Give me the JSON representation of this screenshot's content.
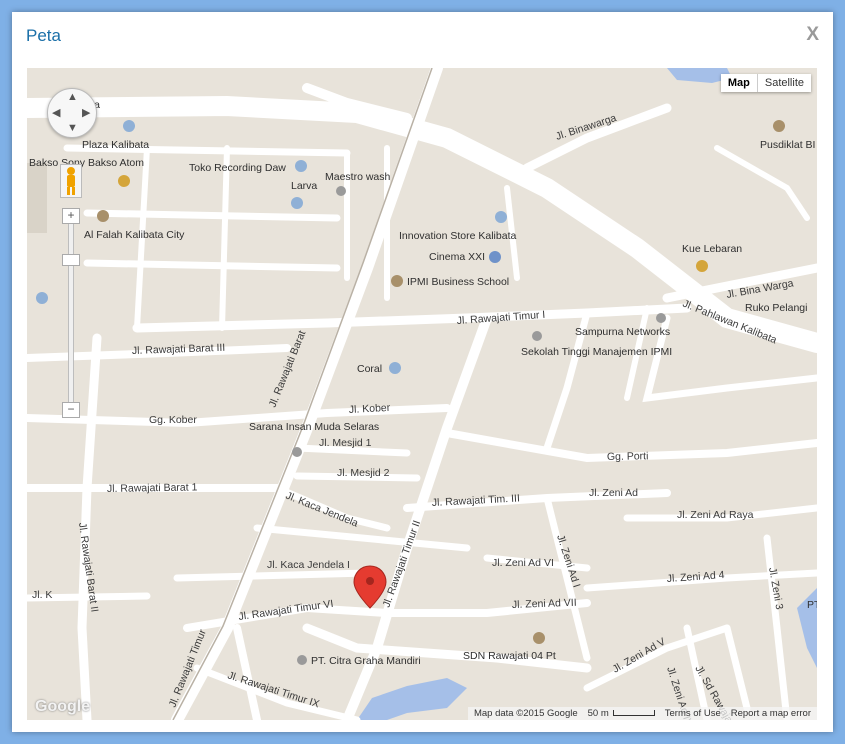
{
  "dialog": {
    "title": "Peta",
    "close_label": "X"
  },
  "map_type": {
    "map_label": "Map",
    "satellite_label": "Satellite",
    "active": "Map"
  },
  "controls": {
    "zoom_in": "+",
    "zoom_out": "−"
  },
  "footer": {
    "map_data": "Map data ©2015 Google",
    "scale": "50 m",
    "terms": "Terms of Use",
    "report": "Report a map error"
  },
  "google_logo": "Google",
  "street_labels": [
    "Jl. Binawarga",
    "Jl. Pahlawan Kalibata",
    "Jl. Bina Warga",
    "Jl. Rawajati Timur I",
    "Jl. Rawajati Barat III",
    "Gg. Kober",
    "Jl. Kober",
    "Jl. Rawajati Barat",
    "Jl. Mesjid 1",
    "Jl. Mesjid 2",
    "Gg. Porti",
    "Jl. Rawajati Barat 1",
    "Jl. Kaca Jendela",
    "Jl. Rawajati Tim. III",
    "Jl. Zeni Ad",
    "Jl. Zeni Ad Raya",
    "Jl. Zeni 3",
    "Jl. Zeni Ad VI",
    "Jl. Zeni Ad I",
    "Jl. Zeni Ad 4",
    "Jl. Kaca Jendela I",
    "Jl. Rawajati Timur II",
    "Jl. Rawajati Barat II",
    "Jl. K",
    "Jl. Rawajati Timur VI",
    "Jl. Zeni Ad VII",
    "Jl. Rawajati Timur",
    "Jl. Rawajati Timur IX",
    "Jl. Zeni Ad V",
    "Jl. Zeni Ad IV",
    "Jl. Sd Rawajati"
  ],
  "places": [
    "Kalibata",
    "Plaza Kalibata",
    "Bakso Sony Bakso Atom",
    "Toko Recording Daw",
    "Maestro wash",
    "Larva",
    "Al Falah Kalibata City",
    "Innovation Store Kalibata",
    "Cinema XXI",
    "IPMI Business School",
    "Pusdiklat BI",
    "Kue Lebaran",
    "Ruko Pelangi",
    "Sampurna Networks",
    "Sekolah Tinggi Manajemen IPMI",
    "Coral",
    "Sarana Insan Muda Selaras",
    "SDN Rawajati 04 Pt",
    "PT. Citra Graha Mandiri",
    "PT"
  ],
  "colors": {
    "marker": "#e53b30",
    "road": "#ffffff",
    "land": "#e8e3da",
    "water": "#a5bfe8",
    "accent": "#1a6fa8"
  }
}
